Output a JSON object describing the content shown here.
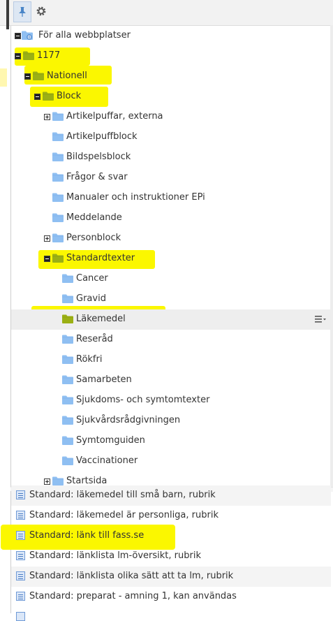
{
  "toolbar": {
    "pin_icon": "pin-icon",
    "gear_icon": "gear-icon"
  },
  "colors": {
    "highlight": "#fbf700",
    "folder_blue": "#8fbff2",
    "folder_green": "#9bb014",
    "selected_row": "#eeeeee"
  },
  "tree": {
    "root": {
      "label": "För alla webbplatser",
      "icon": "globe-folder-icon"
    },
    "nodes": [
      {
        "label": "1177",
        "state": "expanded",
        "color": "green"
      },
      {
        "label": "Nationell",
        "state": "expanded",
        "color": "green"
      },
      {
        "label": "Block",
        "state": "expanded",
        "color": "green"
      },
      {
        "label": "Artikelpuffar, externa",
        "state": "collapsed",
        "color": "blue"
      },
      {
        "label": "Artikelpuffblock",
        "state": "leaf",
        "color": "blue"
      },
      {
        "label": "Bildspelsblock",
        "state": "leaf",
        "color": "blue"
      },
      {
        "label": "Frågor & svar",
        "state": "leaf",
        "color": "blue"
      },
      {
        "label": "Manualer och instruktioner EPi",
        "state": "leaf",
        "color": "blue"
      },
      {
        "label": "Meddelande",
        "state": "leaf",
        "color": "blue"
      },
      {
        "label": "Personblock",
        "state": "collapsed",
        "color": "blue"
      },
      {
        "label": "Standardtexter",
        "state": "expanded",
        "color": "green"
      },
      {
        "label": "Cancer",
        "state": "leaf",
        "color": "blue"
      },
      {
        "label": "Gravid",
        "state": "leaf",
        "color": "blue"
      },
      {
        "label": "Läkemedel",
        "state": "leaf",
        "color": "green",
        "selected": true
      },
      {
        "label": "Reseråd",
        "state": "leaf",
        "color": "blue"
      },
      {
        "label": "Rökfri",
        "state": "leaf",
        "color": "blue"
      },
      {
        "label": "Samarbeten",
        "state": "leaf",
        "color": "blue"
      },
      {
        "label": "Sjukdoms- och symtomtexter",
        "state": "leaf",
        "color": "blue"
      },
      {
        "label": "Sjukvårdsrådgivningen",
        "state": "leaf",
        "color": "blue"
      },
      {
        "label": "Symtomguiden",
        "state": "leaf",
        "color": "blue"
      },
      {
        "label": "Vaccinationer",
        "state": "leaf",
        "color": "blue"
      },
      {
        "label": "Startsida",
        "state": "collapsed",
        "color": "blue"
      }
    ]
  },
  "blocks": [
    {
      "label": "Standard: läkemedel till små barn, rubrik"
    },
    {
      "label": "Standard: läkemedel är personliga, rubrik"
    },
    {
      "label": "Standard: länk till fass.se",
      "highlighted": true
    },
    {
      "label": "Standard: länklista lm-översikt, rubrik"
    },
    {
      "label": "Standard: länklista olika sätt att ta lm, rubrik"
    },
    {
      "label": "Standard: preparat - amning 1, kan användas"
    }
  ]
}
